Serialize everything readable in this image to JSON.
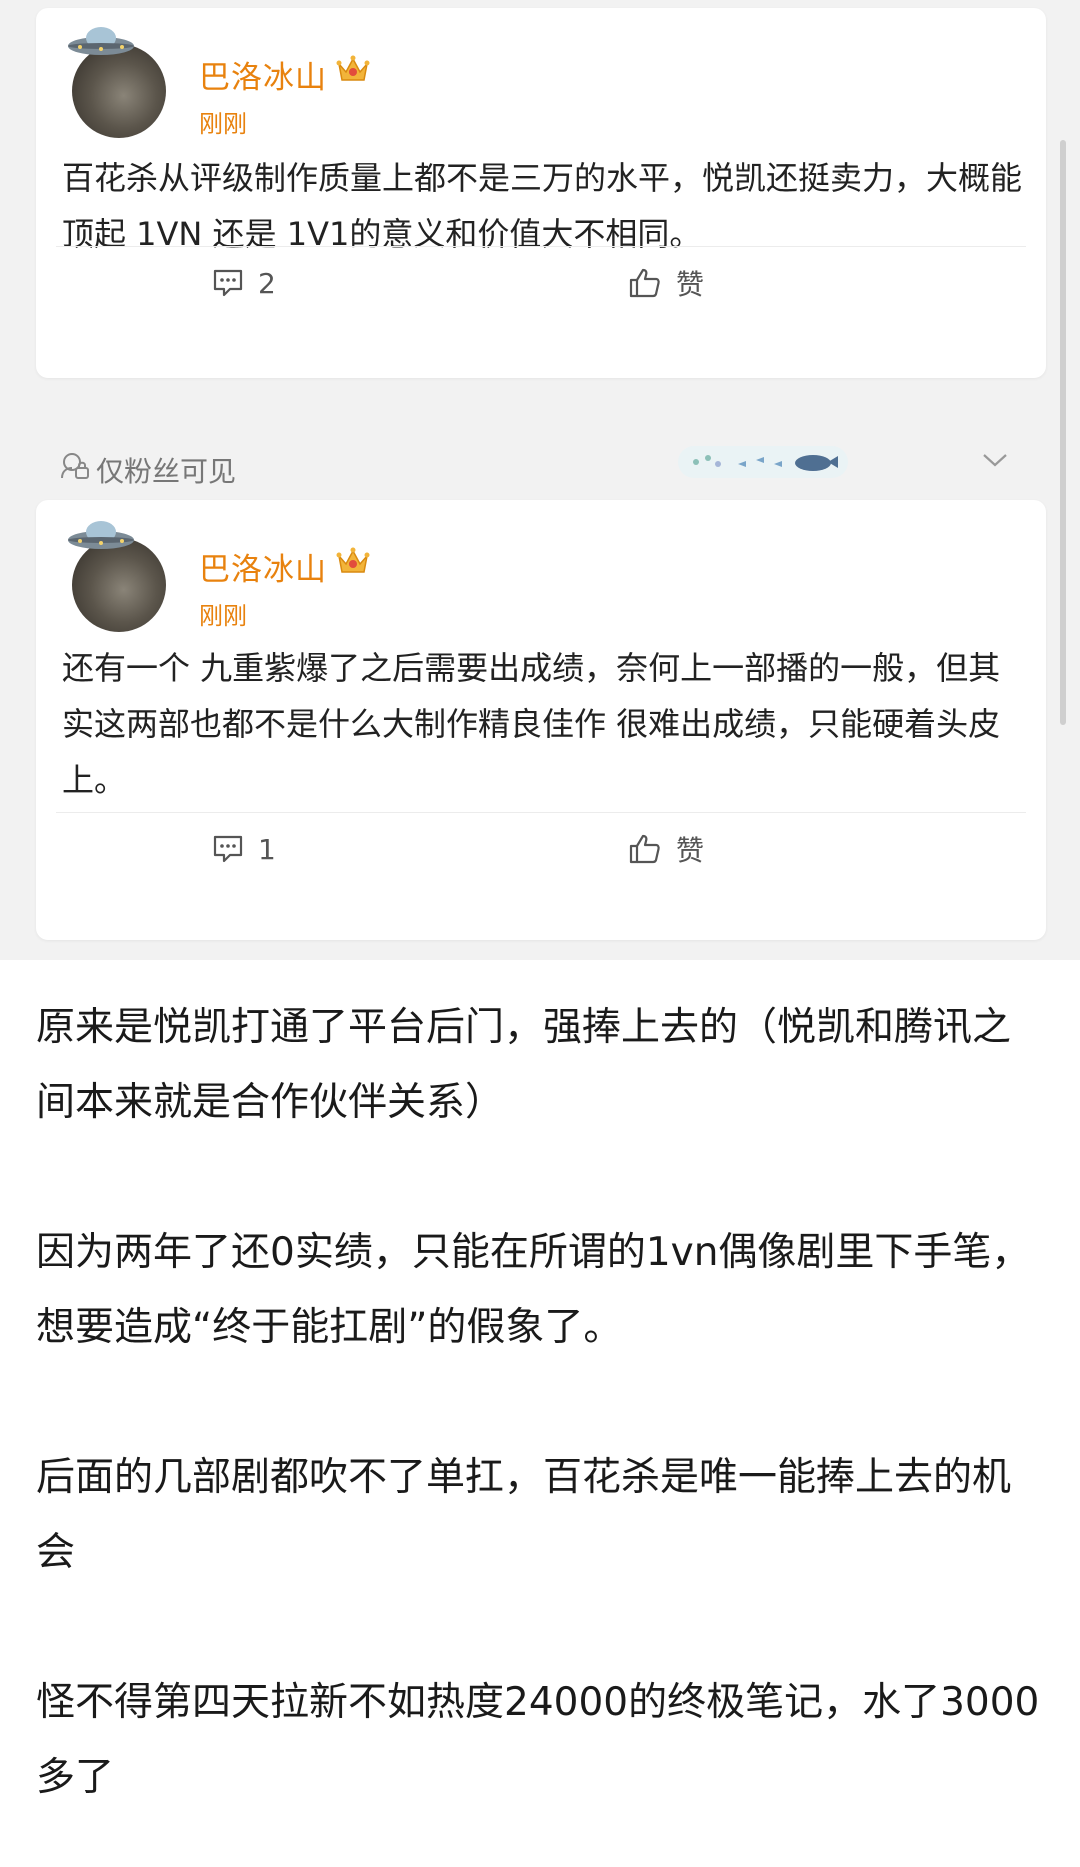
{
  "comments": [
    {
      "username": "巴洛冰山",
      "time": "刚刚",
      "text": "百花杀从评级制作质量上都不是三万的水平，悦凯还挺卖力，大概能顶起 1VN 还是 1V1的意义和价值大不相同。",
      "reply_count": "2",
      "like_label": "赞"
    },
    {
      "username": "巴洛冰山",
      "time": "刚刚",
      "text": "还有一个 九重紫爆了之后需要出成绩，奈何上一部播的一般，但其实这两部也都不是什么大制作精良佳作 很难出成绩，只能硬着头皮上。",
      "reply_count": "1",
      "like_label": "赞"
    }
  ],
  "visibility_label": "仅粉丝可见",
  "article": [
    "原来是悦凯打通了平台后门，强捧上去的（悦凯和腾讯之间本来就是合作伙伴关系）",
    "因为两年了还0实绩，只能在所谓的1vn偶像剧里下手笔，想要造成“终于能扛剧”的假象了。",
    "后面的几部剧都吹不了单扛，百花杀是唯一能捧上去的机会",
    "怪不得第四天拉新不如热度24000的终极笔记，水了3000多了"
  ],
  "colors": {
    "username": "#e8820e",
    "background": "#f2f2f2"
  }
}
